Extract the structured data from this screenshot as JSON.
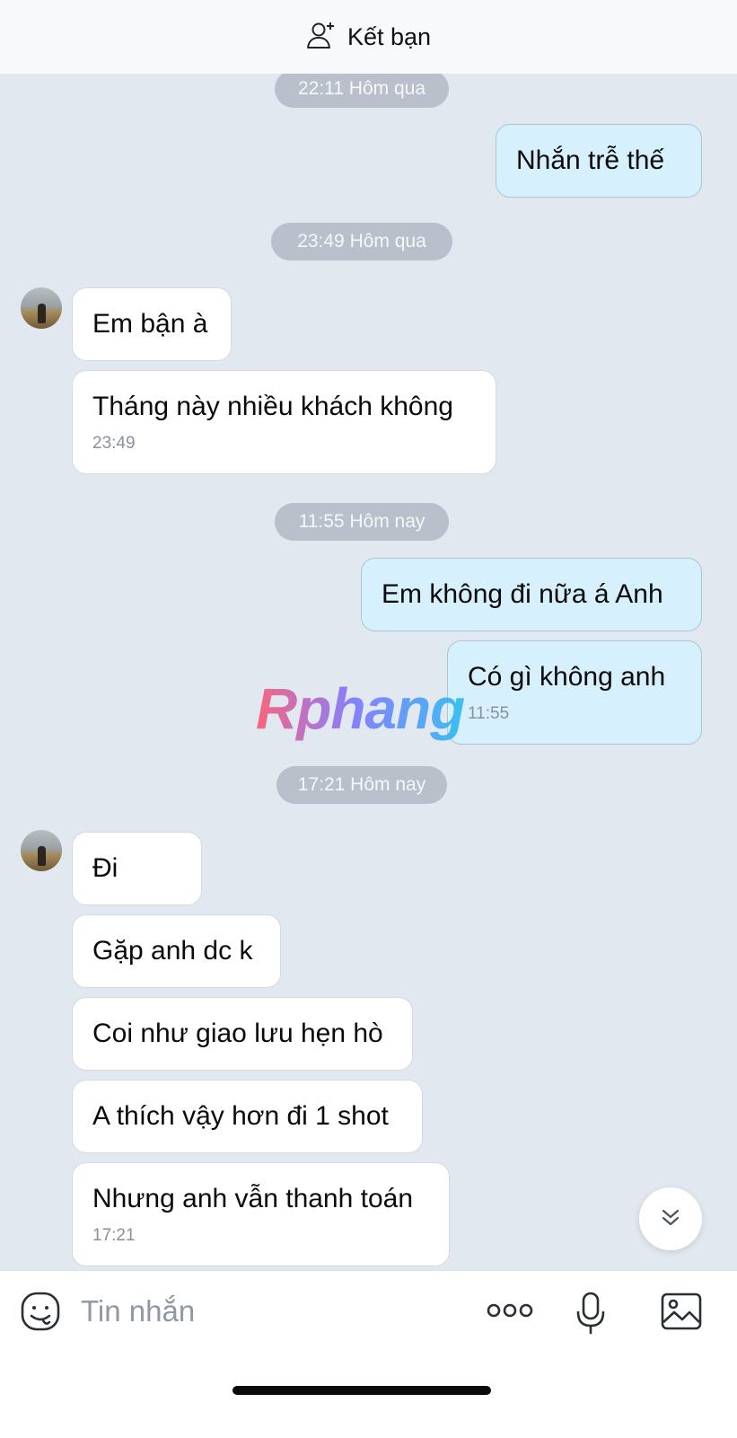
{
  "header": {
    "add_friend_label": "Kết bạn"
  },
  "timestamps": {
    "t1": "22:11 Hôm qua",
    "t2": "23:49 Hôm qua",
    "t3": "11:55 Hôm nay",
    "t4": "17:21 Hôm nay"
  },
  "messages": [
    {
      "side": "out",
      "text": "Nhắn trễ thế"
    },
    {
      "side": "in",
      "text": "Em bận à"
    },
    {
      "side": "in",
      "text": "Tháng này nhiều khách không",
      "time": "23:49"
    },
    {
      "side": "out",
      "text": "Em không đi nữa á Anh"
    },
    {
      "side": "out",
      "text": "Có gì không anh",
      "time": "11:55"
    },
    {
      "side": "in",
      "text": "Đi"
    },
    {
      "side": "in",
      "text": "Gặp anh dc k"
    },
    {
      "side": "in",
      "text": "Coi như giao lưu hẹn hò"
    },
    {
      "side": "in",
      "text": "A thích vậy hơn đi 1 shot"
    },
    {
      "side": "in",
      "text": "Nhưng anh vẫn thanh toán",
      "time": "17:21"
    }
  ],
  "watermark": "Rphang",
  "input": {
    "placeholder": "Tin nhắn"
  },
  "icons": {
    "add_friend": "person-add-icon",
    "emoji": "emoji-icon",
    "more": "more-icon",
    "mic": "mic-icon",
    "image": "image-icon",
    "scroll_down": "chevron-double-down-icon"
  },
  "colors": {
    "background": "#e2e8f0",
    "incoming_bubble": "#ffffff",
    "outgoing_bubble": "#d6f1fd",
    "timestamp_pill": "#b9c0cb"
  }
}
